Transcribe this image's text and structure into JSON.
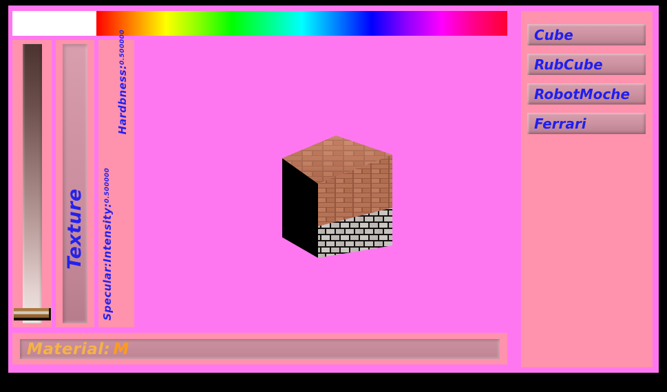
{
  "window": {
    "background_color": "#000000",
    "frame_color": "#ff77f0",
    "panel_color": "#ff92ad"
  },
  "top_bar": {
    "current_color_swatch": {
      "name": "current-color",
      "color": "#ffffff"
    },
    "hue_strip": {
      "name": "hue-gradient",
      "stops": [
        "#ff0000",
        "#ff8800",
        "#ffff00",
        "#88ff00",
        "#00ff00",
        "#00ff88",
        "#00ffff",
        "#0088ff",
        "#0000ff",
        "#8800ff",
        "#ff00ff",
        "#ff0088",
        "#ff0033"
      ]
    }
  },
  "sliders": {
    "shade_slider": {
      "label": "",
      "handle_position_percent": 3,
      "track_top_color": "#4a3330",
      "track_bottom_color": "#f0e6e3",
      "handle_color": "#a9773f"
    },
    "texture_slider": {
      "label": "Texture",
      "track_color": "#cf94a3",
      "text_color": "#2222ee"
    }
  },
  "readouts": {
    "specular_intensity": {
      "label": "Specular:Intensity:",
      "value": "0.500000"
    },
    "hardness": {
      "label": "Hardbness:",
      "value": "0.500000"
    },
    "text_color": "#2222ee"
  },
  "viewport": {
    "background_color": "#ff77f0",
    "object": "textured-cube",
    "faces": {
      "top": "red-brick",
      "front_right_upper": "red-brick",
      "front_right_lower": "grey-stone-brick",
      "left": "shadow-black"
    }
  },
  "object_list": {
    "buttons": [
      {
        "label": "Cube"
      },
      {
        "label": "RubCube"
      },
      {
        "label": "RobotMoche"
      },
      {
        "label": "Ferrari"
      }
    ],
    "text_color": "#1f1fee",
    "button_color": "#cf94a3"
  },
  "status_bar": {
    "key": "Material:",
    "value": "M",
    "key_color": "#f6b248",
    "value_color": "#ff9b1c"
  }
}
